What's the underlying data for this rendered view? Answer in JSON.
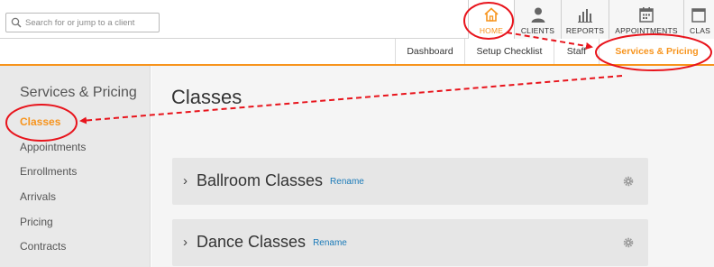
{
  "search": {
    "placeholder": "Search for or jump to a client"
  },
  "nav_tabs": [
    {
      "label": "HOME",
      "icon": "home-icon",
      "active": true
    },
    {
      "label": "CLIENTS",
      "icon": "person-icon",
      "active": false
    },
    {
      "label": "REPORTS",
      "icon": "bar-chart-icon",
      "active": false
    },
    {
      "label": "APPOINTMENTS",
      "icon": "calendar-icon",
      "active": false
    },
    {
      "label": "CLAS",
      "icon": "calendar-icon",
      "active": false
    }
  ],
  "sub_nav": [
    {
      "label": "Dashboard",
      "active": false
    },
    {
      "label": "Setup Checklist",
      "active": false
    },
    {
      "label": "Staff",
      "active": false
    },
    {
      "label": "Services & Pricing",
      "active": true
    }
  ],
  "sidebar": {
    "title": "Services & Pricing",
    "items": [
      {
        "label": "Classes",
        "active": true
      },
      {
        "label": "Appointments",
        "active": false
      },
      {
        "label": "Enrollments",
        "active": false
      },
      {
        "label": "Arrivals",
        "active": false
      },
      {
        "label": "Pricing",
        "active": false
      },
      {
        "label": "Contracts",
        "active": false
      }
    ]
  },
  "main": {
    "title": "Classes",
    "class_groups": [
      {
        "name": "Ballroom Classes",
        "rename_label": "Rename",
        "chevron": "›"
      },
      {
        "name": "Dance Classes",
        "rename_label": "Rename",
        "chevron": "›"
      }
    ]
  },
  "colors": {
    "accent": "#f7941d",
    "annotation_red": "#e8141c",
    "link_blue": "#1a7ab8"
  }
}
